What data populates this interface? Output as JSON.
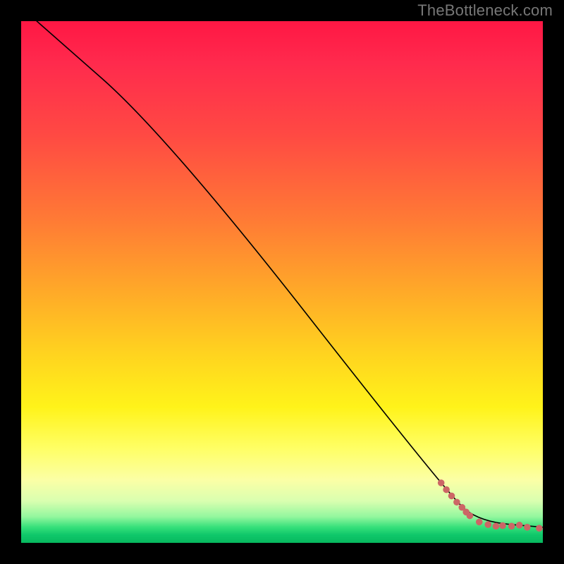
{
  "watermark": "TheBottleneck.com",
  "gradient_colors": {
    "top": "#ff1744",
    "mid_upper": "#ff7a35",
    "mid": "#ffd41f",
    "mid_lower": "#fff31a",
    "lower": "#d9ffb0",
    "bottom": "#0fc76a"
  },
  "chart_data": {
    "type": "line",
    "title": "",
    "xlabel": "",
    "ylabel": "",
    "xlim": [
      0,
      100
    ],
    "ylim": [
      0,
      100
    ],
    "grid": false,
    "curve": {
      "name": "bottleneck-curve",
      "color": "#000000",
      "width": 1.6,
      "points": [
        {
          "x": 3,
          "y": 100
        },
        {
          "x": 28,
          "y": 78
        },
        {
          "x": 82,
          "y": 9
        },
        {
          "x": 88,
          "y": 4
        },
        {
          "x": 100,
          "y": 3
        }
      ]
    },
    "markers": {
      "name": "data-points",
      "color": "#cc6666",
      "points": [
        {
          "x": 80.5,
          "y": 11.5
        },
        {
          "x": 81.5,
          "y": 10.2
        },
        {
          "x": 82.5,
          "y": 9.0
        },
        {
          "x": 83.5,
          "y": 7.8
        },
        {
          "x": 84.5,
          "y": 6.8
        },
        {
          "x": 85.3,
          "y": 5.9
        },
        {
          "x": 86.0,
          "y": 5.2
        },
        {
          "x": 87.8,
          "y": 4.0
        },
        {
          "x": 89.5,
          "y": 3.5
        },
        {
          "x": 91.0,
          "y": 3.2
        },
        {
          "x": 92.3,
          "y": 3.3
        },
        {
          "x": 94.0,
          "y": 3.2
        },
        {
          "x": 95.5,
          "y": 3.4
        },
        {
          "x": 97.0,
          "y": 3.0
        },
        {
          "x": 99.3,
          "y": 2.8
        }
      ]
    }
  }
}
